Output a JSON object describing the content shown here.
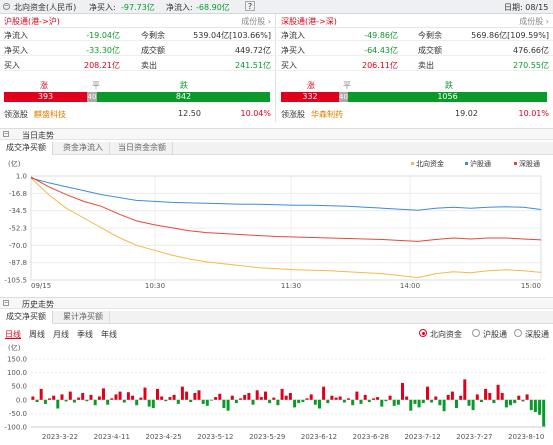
{
  "topbar": {
    "title": "北向资金(人民币)",
    "netbuy_label": "净买入:",
    "netbuy_val": "-97.73亿",
    "netin_label": "净流入:",
    "netin_val": "-68.90亿",
    "help": "?",
    "date": "日期: 08/15"
  },
  "sh": {
    "title": "沪股通(港->沪)",
    "constituents": "成份股 ›",
    "netin_l": "净流入",
    "netin_v": "-19.04亿",
    "remain_l": "今剩余",
    "remain_v": "539.04亿[103.66%]",
    "netbuy_l": "净买入",
    "netbuy_v": "-33.30亿",
    "vol_l": "成交额",
    "vol_v": "449.72亿",
    "buy_l": "买入",
    "buy_v": "208.21亿",
    "sell_l": "卖出",
    "sell_v": "241.51亿",
    "up_l": "涨",
    "flat_l": "平",
    "down_l": "跌",
    "up_n": "393",
    "flat_n": "40",
    "down_n": "842",
    "lead_l": "领涨股",
    "lead_name": "麒盛科技",
    "lead_price": "12.50",
    "lead_pct": "10.04%"
  },
  "sz": {
    "title": "深股通(港->深)",
    "constituents": "成份股 ›",
    "netin_l": "净流入",
    "netin_v": "-49.86亿",
    "remain_l": "今剩余",
    "remain_v": "569.86亿[109.59%]",
    "netbuy_l": "净买入",
    "netbuy_v": "-64.43亿",
    "vol_l": "成交额",
    "vol_v": "476.66亿",
    "buy_l": "买入",
    "buy_v": "206.11亿",
    "sell_l": "卖出",
    "sell_v": "270.55亿",
    "up_l": "涨",
    "flat_l": "平",
    "down_l": "跌",
    "up_n": "332",
    "flat_n": "40",
    "down_n": "1056",
    "lead_l": "领涨股",
    "lead_name": "华森制药",
    "lead_price": "19.02",
    "lead_pct": "10.01%"
  },
  "today": {
    "title": "当日走势",
    "tabs": [
      "成交净买额",
      "资金净流入",
      "当日资金余额"
    ]
  },
  "history": {
    "title": "历史走势",
    "tabs": [
      "成交净买额",
      "累计净买额"
    ],
    "periods": [
      "日线",
      "周线",
      "月线",
      "季线",
      "年线"
    ],
    "radios": [
      "北向资金",
      "沪股通",
      "深股通"
    ]
  },
  "colors": {
    "north": "#f5b84a",
    "sh": "#3d8bd9",
    "sz": "#e8473a",
    "up": "#e0001b",
    "down": "#0a9a2a"
  },
  "chart_data": [
    {
      "type": "line",
      "ylabel": "(亿)",
      "yticks": [
        "1.0",
        "-16.8",
        "-34.5",
        "-52.3",
        "-70.0",
        "-87.8",
        "-105.5"
      ],
      "ylim": [
        -105.5,
        1.0
      ],
      "xticks": [
        "09/15",
        "10:30",
        "11:30",
        "14:00",
        "15:00"
      ],
      "series": [
        {
          "name": "北向资金",
          "values": [
            -1,
            -18,
            -32,
            -42,
            -52,
            -62,
            -70,
            -75,
            -80,
            -84,
            -87,
            -89,
            -91,
            -93,
            -94,
            -95,
            -95.5,
            -96,
            -97,
            -98,
            -99,
            -101,
            -103,
            -99,
            -97,
            -98,
            -96,
            -95,
            -96,
            -97.7
          ]
        },
        {
          "name": "沪股通",
          "values": [
            -1,
            -6,
            -10,
            -14,
            -18,
            -21,
            -24,
            -25,
            -26,
            -26.5,
            -27,
            -27.5,
            -28,
            -28,
            -28.5,
            -29,
            -29,
            -29.5,
            -30,
            -31,
            -32,
            -33,
            -34,
            -32,
            -31,
            -32,
            -31,
            -30.5,
            -31,
            -33.3
          ]
        },
        {
          "name": "深股通",
          "values": [
            0,
            -10,
            -18,
            -25,
            -30,
            -38,
            -45,
            -49,
            -52,
            -55,
            -57,
            -58,
            -59,
            -60,
            -61,
            -61.5,
            -62,
            -62.5,
            -63,
            -63.5,
            -64,
            -65,
            -66,
            -64,
            -62.5,
            -63.5,
            -62.5,
            -62.5,
            -63.5,
            -64.4
          ]
        }
      ]
    },
    {
      "type": "bar",
      "ylabel": "(亿)",
      "yticks": [
        "150.0",
        "100.0",
        "50.0",
        "0.0",
        "-50.0",
        "-100.0"
      ],
      "ylim": [
        -100,
        150
      ],
      "xticks": [
        "2023-3-22",
        "2023-4-11",
        "2023-4-25",
        "2023-5-12",
        "2023-5-29",
        "2023-6-12",
        "2023-6-28",
        "2023-7-12",
        "2023-7-27",
        "2023-8-10"
      ],
      "series": [
        {
          "name": "北向资金",
          "values": [
            12,
            -8,
            40,
            -15,
            5,
            15,
            -32,
            20,
            -6,
            30,
            -10,
            8,
            25,
            -5,
            18,
            -20,
            12,
            42,
            -18,
            5,
            20,
            30,
            -10,
            28,
            15,
            -20,
            8,
            45,
            -25,
            -30,
            40,
            12,
            -5,
            10,
            18,
            -15,
            48,
            30,
            -8,
            25,
            35,
            -15,
            -22,
            -3,
            10,
            22,
            -30,
            -40,
            15,
            -12,
            5,
            18,
            25,
            -18,
            35,
            10,
            30,
            -12,
            8,
            -20,
            40,
            15,
            25,
            -28,
            -12,
            -8,
            5,
            20,
            -18,
            -32,
            48,
            -12,
            15,
            8,
            12,
            -10,
            5,
            -20,
            30,
            -15,
            18,
            -8,
            5,
            10,
            -25,
            -5,
            15,
            -22,
            -18,
            62,
            12,
            -40,
            -15,
            -28,
            -12,
            48,
            -10,
            12,
            -20,
            -42,
            18,
            30,
            -30,
            15,
            75,
            -22,
            -38,
            20,
            -8,
            40,
            25,
            -12,
            55,
            25,
            -28,
            -20,
            -12,
            15,
            -6,
            20,
            -38,
            -45,
            -55,
            -97.7
          ]
        }
      ]
    }
  ]
}
